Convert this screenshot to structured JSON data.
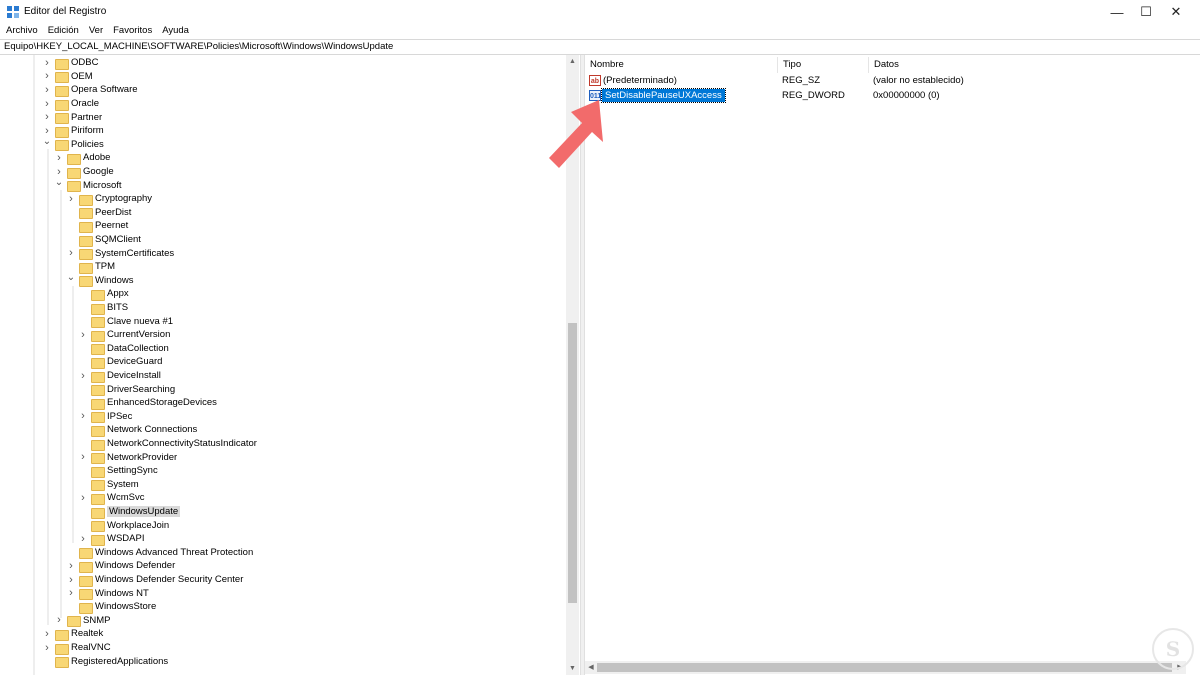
{
  "window": {
    "title": "Editor del Registro",
    "minimize_glyph": "—",
    "maximize_glyph": "☐",
    "close_glyph": "✕"
  },
  "menu": [
    "Archivo",
    "Edición",
    "Ver",
    "Favoritos",
    "Ayuda"
  ],
  "address": "Equipo\\HKEY_LOCAL_MACHINE\\SOFTWARE\\Policies\\Microsoft\\Windows\\WindowsUpdate",
  "tree": [
    {
      "label": "ODBC",
      "depth": 0,
      "expander": "collapsed"
    },
    {
      "label": "OEM",
      "depth": 0,
      "expander": "collapsed"
    },
    {
      "label": "Opera Software",
      "depth": 0,
      "expander": "collapsed"
    },
    {
      "label": "Oracle",
      "depth": 0,
      "expander": "collapsed"
    },
    {
      "label": "Partner",
      "depth": 0,
      "expander": "collapsed"
    },
    {
      "label": "Piriform",
      "depth": 0,
      "expander": "collapsed"
    },
    {
      "label": "Policies",
      "depth": 0,
      "expander": "expanded"
    },
    {
      "label": "Adobe",
      "depth": 1,
      "expander": "collapsed"
    },
    {
      "label": "Google",
      "depth": 1,
      "expander": "collapsed"
    },
    {
      "label": "Microsoft",
      "depth": 1,
      "expander": "expanded"
    },
    {
      "label": "Cryptography",
      "depth": 2,
      "expander": "collapsed"
    },
    {
      "label": "PeerDist",
      "depth": 2,
      "expander": "none"
    },
    {
      "label": "Peernet",
      "depth": 2,
      "expander": "none"
    },
    {
      "label": "SQMClient",
      "depth": 2,
      "expander": "none"
    },
    {
      "label": "SystemCertificates",
      "depth": 2,
      "expander": "collapsed"
    },
    {
      "label": "TPM",
      "depth": 2,
      "expander": "none"
    },
    {
      "label": "Windows",
      "depth": 2,
      "expander": "expanded"
    },
    {
      "label": "Appx",
      "depth": 3,
      "expander": "none"
    },
    {
      "label": "BITS",
      "depth": 3,
      "expander": "none"
    },
    {
      "label": "Clave nueva #1",
      "depth": 3,
      "expander": "none"
    },
    {
      "label": "CurrentVersion",
      "depth": 3,
      "expander": "collapsed"
    },
    {
      "label": "DataCollection",
      "depth": 3,
      "expander": "none"
    },
    {
      "label": "DeviceGuard",
      "depth": 3,
      "expander": "none"
    },
    {
      "label": "DeviceInstall",
      "depth": 3,
      "expander": "collapsed"
    },
    {
      "label": "DriverSearching",
      "depth": 3,
      "expander": "none"
    },
    {
      "label": "EnhancedStorageDevices",
      "depth": 3,
      "expander": "none"
    },
    {
      "label": "IPSec",
      "depth": 3,
      "expander": "collapsed"
    },
    {
      "label": "Network Connections",
      "depth": 3,
      "expander": "none"
    },
    {
      "label": "NetworkConnectivityStatusIndicator",
      "depth": 3,
      "expander": "none"
    },
    {
      "label": "NetworkProvider",
      "depth": 3,
      "expander": "collapsed"
    },
    {
      "label": "SettingSync",
      "depth": 3,
      "expander": "none"
    },
    {
      "label": "System",
      "depth": 3,
      "expander": "none"
    },
    {
      "label": "WcmSvc",
      "depth": 3,
      "expander": "collapsed"
    },
    {
      "label": "WindowsUpdate",
      "depth": 3,
      "expander": "none",
      "selected": true
    },
    {
      "label": "WorkplaceJoin",
      "depth": 3,
      "expander": "none"
    },
    {
      "label": "WSDAPI",
      "depth": 3,
      "expander": "collapsed"
    },
    {
      "label": "Windows Advanced Threat Protection",
      "depth": 2,
      "expander": "none"
    },
    {
      "label": "Windows Defender",
      "depth": 2,
      "expander": "collapsed"
    },
    {
      "label": "Windows Defender Security Center",
      "depth": 2,
      "expander": "collapsed"
    },
    {
      "label": "Windows NT",
      "depth": 2,
      "expander": "collapsed"
    },
    {
      "label": "WindowsStore",
      "depth": 2,
      "expander": "none"
    },
    {
      "label": "SNMP",
      "depth": 1,
      "expander": "collapsed"
    },
    {
      "label": "Realtek",
      "depth": 0,
      "expander": "collapsed"
    },
    {
      "label": "RealVNC",
      "depth": 0,
      "expander": "collapsed"
    },
    {
      "label": "RegisteredApplications",
      "depth": 0,
      "expander": "none"
    }
  ],
  "columns": {
    "name": "Nombre",
    "type": "Tipo",
    "data": "Datos"
  },
  "values": [
    {
      "name": "(Predeterminado)",
      "type": "REG_SZ",
      "data": "(valor no establecido)",
      "icon": "string-value-icon",
      "icon_text": "ab",
      "selected": false
    },
    {
      "name": "SetDisablePauseUXAccess",
      "type": "REG_DWORD",
      "data": "0x00000000 (0)",
      "icon": "dword-value-icon",
      "icon_text": "011",
      "selected": true
    }
  ],
  "annotation": {
    "color": "#f26b6b"
  },
  "watermark": "S",
  "colors": {
    "selection": "#0078d7",
    "folder": "#f8d775"
  }
}
